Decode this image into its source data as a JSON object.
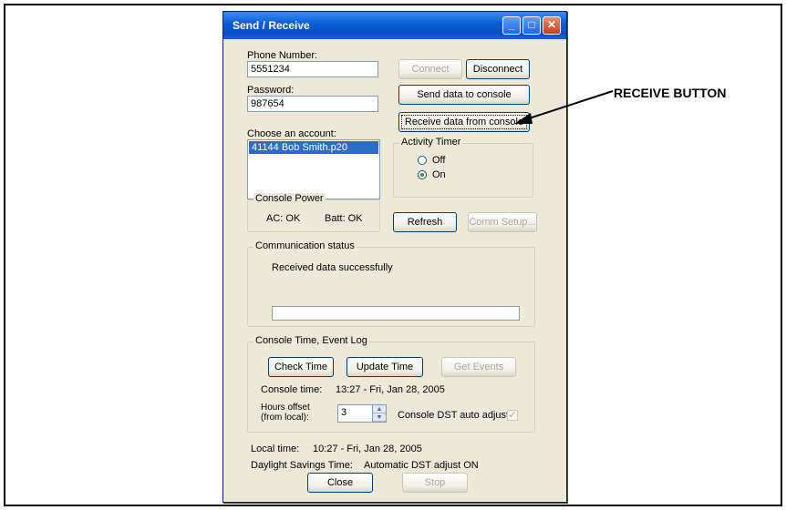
{
  "window": {
    "title": "Send / Receive",
    "minimize_glyph": "_",
    "maximize_glyph": "□",
    "close_glyph": "✕"
  },
  "phone": {
    "label": "Phone Number:",
    "value": "5551234"
  },
  "password": {
    "label": "Password:",
    "value": "987654"
  },
  "account": {
    "label": "Choose an account:",
    "items": [
      "41144 Bob Smith.p20"
    ]
  },
  "buttons": {
    "connect": "Connect",
    "disconnect": "Disconnect",
    "send_data": "Send data to console",
    "receive_data": "Receive data from console",
    "refresh": "Refresh",
    "comm_setup": "Comm Setup...",
    "check_time": "Check Time",
    "update_time": "Update Time",
    "get_events": "Get Events",
    "close": "Close",
    "stop": "Stop"
  },
  "activity_timer": {
    "title": "Activity Timer",
    "off_label": "Off",
    "on_label": "On",
    "selected": "On"
  },
  "console_power": {
    "title": "Console Power",
    "ac": "AC: OK",
    "batt": "Batt: OK"
  },
  "comm_status": {
    "title": "Communication status",
    "message": "Received data successfully",
    "progress": 0
  },
  "event_log": {
    "title": "Console Time, Event Log",
    "console_time_label": "Console time:",
    "console_time_value": "13:27  -  Fri, Jan 28, 2005",
    "hours_offset_label_1": "Hours offset",
    "hours_offset_label_2": "(from local):",
    "hours_offset_value": "3",
    "dst_label": "Console DST auto adjust:",
    "dst_checked": true
  },
  "local_time": {
    "label": "Local time:",
    "value": "10:27  -  Fri, Jan 28, 2005"
  },
  "dst": {
    "label": "Daylight Savings Time:",
    "value": "Automatic DST adjust ON"
  },
  "annotation": {
    "label": "RECEIVE BUTTON"
  }
}
